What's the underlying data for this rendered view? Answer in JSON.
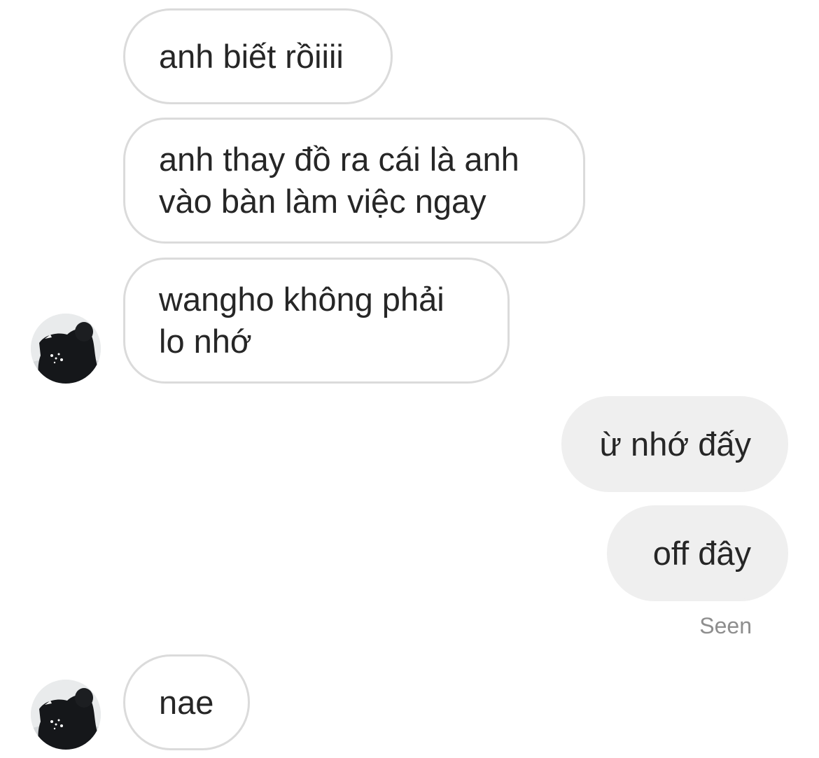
{
  "conversation": {
    "messages": [
      {
        "direction": "received",
        "text": "anh biết rồiiii"
      },
      {
        "direction": "received",
        "text": "anh thay đồ ra cái là anh\nvào bàn làm việc ngay"
      },
      {
        "direction": "received",
        "text": "wangho không phải\nlo nhớ"
      },
      {
        "direction": "sent",
        "text": "ừ nhớ đấy"
      },
      {
        "direction": "sent",
        "text": "off đây"
      },
      {
        "direction": "received",
        "text": "nae"
      }
    ],
    "seen_label": "Seen"
  },
  "avatars": [
    {
      "icon": "profile-photo-icon"
    },
    {
      "icon": "profile-photo-icon"
    }
  ],
  "colors": {
    "received_bubble_border": "#dbdbdb",
    "sent_bubble_background": "#efefef",
    "text": "#262626",
    "status_text": "#8e8e8e"
  }
}
